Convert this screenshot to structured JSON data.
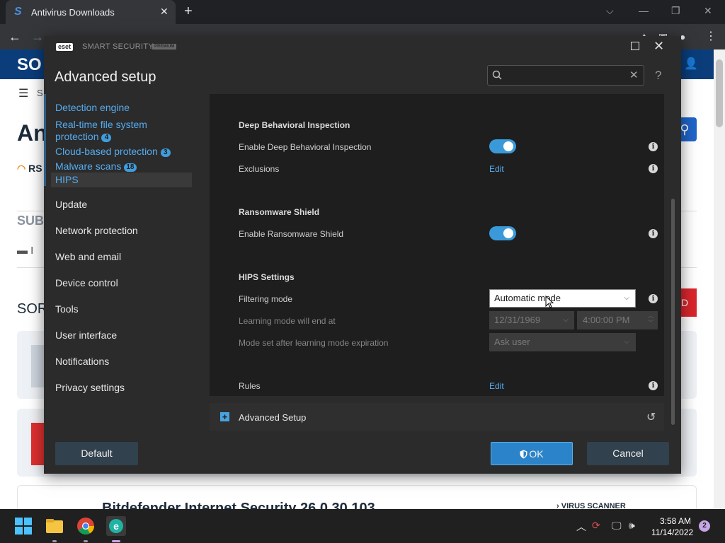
{
  "browser": {
    "tab_title": "Antivirus Downloads",
    "tab_close": "✕",
    "new_tab": "+",
    "favicon_letter": "S",
    "controls": {
      "minimize": "—",
      "restore": "❐",
      "close": "✕",
      "tabsearch": "⌵"
    }
  },
  "page": {
    "logo": "SO",
    "heading": "An",
    "rss": "RS",
    "menu_text": "S",
    "subheading": "SUB",
    "folder_text": "I",
    "sort_label": "SOR",
    "bottom_title": "Bitdefender Internet Security 26.0.30.103",
    "virus_label": "VIRUS SCANNER"
  },
  "dialog": {
    "product": "SMART SECURITY",
    "premium": "PREMIUM",
    "eset_logo": "eset",
    "title": "Advanced setup",
    "search": {
      "placeholder": ""
    },
    "help": "?",
    "sidebar": {
      "items": [
        {
          "label": "Detection engine",
          "badge": ""
        },
        {
          "label": "Real-time file system",
          "label2": "protection",
          "badge": "4"
        },
        {
          "label": "Cloud-based protection",
          "badge": "3"
        },
        {
          "label": "Malware scans",
          "badge": "18"
        },
        {
          "label": "HIPS",
          "badge": ""
        },
        {
          "label": "Update"
        },
        {
          "label": "Network protection"
        },
        {
          "label": "Web and email"
        },
        {
          "label": "Device control"
        },
        {
          "label": "Tools"
        },
        {
          "label": "User interface"
        },
        {
          "label": "Notifications"
        },
        {
          "label": "Privacy settings"
        }
      ]
    },
    "content": {
      "dbi": {
        "title": "Deep Behavioral Inspection",
        "enable_label": "Enable Deep Behavioral Inspection",
        "enable_value": true,
        "exclusions_label": "Exclusions",
        "exclusions_action": "Edit"
      },
      "ransomware": {
        "title": "Ransomware Shield",
        "enable_label": "Enable Ransomware Shield",
        "enable_value": true
      },
      "hips": {
        "title": "HIPS Settings",
        "filtering_label": "Filtering mode",
        "filtering_value": "Automatic mode",
        "learning_label": "Learning mode will end at",
        "learning_date": "12/31/1969",
        "learning_time": "4:00:00 PM",
        "expiration_label": "Mode set after learning mode expiration",
        "expiration_value": "Ask user",
        "rules_label": "Rules",
        "rules_action": "Edit"
      }
    },
    "advanced_setup_label": "Advanced Setup",
    "buttons": {
      "default": "Default",
      "ok": "OK",
      "cancel": "Cancel"
    }
  },
  "taskbar": {
    "time": "3:58 AM",
    "date": "11/14/2022",
    "notifications": "2"
  },
  "colors": {
    "accent": "#3a9ad9",
    "link": "#55acf0",
    "dialog_bg": "#2b2b2b",
    "content_bg": "#1e1e1e"
  }
}
